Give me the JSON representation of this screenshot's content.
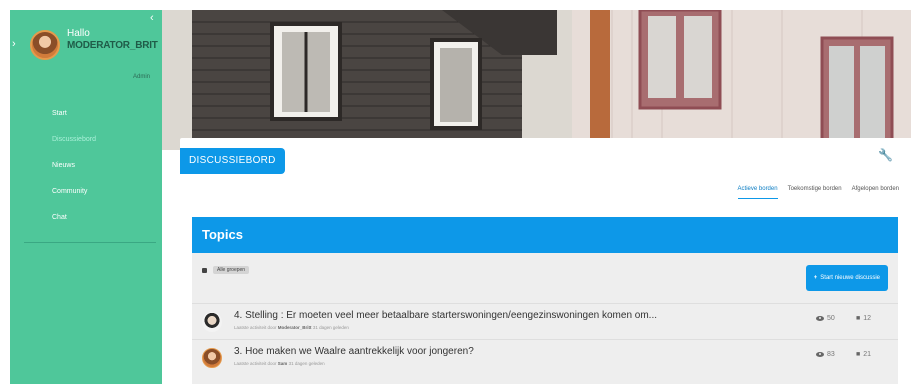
{
  "sidebar": {
    "greeting": "Hallo",
    "username": "MODERATOR_BRIT",
    "role": "Admin",
    "collapse_icon": "‹",
    "expand_icon": "›",
    "nav": [
      {
        "label": "Start",
        "active": false
      },
      {
        "label": "Discussiebord",
        "active": true
      },
      {
        "label": "Nieuws",
        "active": false
      },
      {
        "label": "Community",
        "active": false
      },
      {
        "label": "Chat",
        "active": false
      }
    ]
  },
  "board": {
    "label": "DISCUSSIEBORD",
    "settings_icon": "wrench-icon",
    "tabs": [
      {
        "label": "Actieve borden",
        "active": true
      },
      {
        "label": "Toekomstige borden",
        "active": false
      },
      {
        "label": "Afgelopen borden",
        "active": false
      }
    ]
  },
  "topics": {
    "heading": "Topics",
    "filter_label": "Alle groepen",
    "start_button": "Start nieuwe discussie",
    "rows": [
      {
        "title": "4. Stelling : Er moeten veel meer betaalbare starterswoningen/eengezinswoningen komen om...",
        "meta_prefix": "Laatste activiteit door",
        "meta_author": "Moderator_Britt",
        "meta_time": "31 dagen geleden",
        "views": "50",
        "replies": "12"
      },
      {
        "title": "3. Hoe maken we Waalre aantrekkelijk voor jongeren?",
        "meta_prefix": "Laatste activiteit door",
        "meta_author": "Sam",
        "meta_time": "31 dagen geleden",
        "views": "83",
        "replies": "21"
      }
    ]
  },
  "colors": {
    "sidebar_bg": "#4fc79a",
    "accent_blue": "#0d98e8"
  }
}
